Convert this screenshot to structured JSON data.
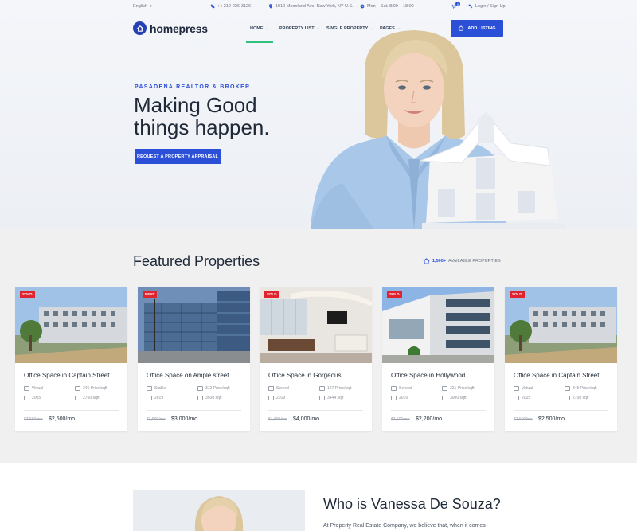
{
  "topbar": {
    "language": "English",
    "phone": "+1 212-226-3126",
    "address": "1010 Moonland Ave, New York, NY U.S.",
    "hours": "Mon – Sat: 8:00 – 18:00",
    "login": "Login / Sign Up",
    "cart_count": "0"
  },
  "header": {
    "logo_text": "homepress",
    "nav": [
      "HOME",
      "PROPERTY LIST",
      "SINGLE PROPERTY",
      "PAGES"
    ],
    "cta_label": "ADD LISTING"
  },
  "hero": {
    "eyebrow": "PASADENA REALTOR & BROKER",
    "headline_line1": "Making Good",
    "headline_line2": "things happen.",
    "cta_label": "REQUEST A PROPERTY APPRAISAL"
  },
  "featured": {
    "title": "Featured Properties",
    "available_count": "1,500+",
    "available_label": "AVAILABLE PROPERTIES",
    "cards": [
      {
        "badge": "SOLD",
        "title": "Office Space in Captain Street",
        "s1": "Virtual",
        "s2": "345 Price/sqft",
        "s3": "2005",
        "s4": "2750 sqft",
        "old_price": "$3,500/mo",
        "price": "$2,500/mo",
        "badge_color": "#e0242f"
      },
      {
        "badge": "RENT",
        "title": "Office Space on Ample street",
        "s1": "Stable",
        "s2": "312 Price/sqft",
        "s3": "2019",
        "s4": "3500 sqft",
        "old_price": "$3,500/mo",
        "price": "$3,000/mo",
        "badge_color": "#e0242f"
      },
      {
        "badge": "SOLD",
        "title": "Office Space in Gorgeous",
        "s1": "Served",
        "s2": "127 Price/sqft",
        "s3": "2019",
        "s4": "3444 sqft",
        "old_price": "$4,800/mo",
        "price": "$4,000/mo",
        "badge_color": "#e0242f"
      },
      {
        "badge": "SOLD",
        "title": "Office Space in Hollywood",
        "s1": "Served",
        "s2": "321 Price/sqft",
        "s3": "2015",
        "s4": "3000 sqft",
        "old_price": "$3,500/mo",
        "price": "$2,200/mo",
        "badge_color": "#e0242f"
      },
      {
        "badge": "SOLD",
        "title": "Office Space in Captain Street",
        "s1": "Virtual",
        "s2": "345 Price/sqft",
        "s3": "2005",
        "s4": "2750 sqft",
        "old_price": "$3,500/mo",
        "price": "$2,500/mo",
        "badge_color": "#e0242f"
      }
    ]
  },
  "who": {
    "title": "Who is Vanessa De Souza?",
    "text": "At Property Real Estate Company, we believe that, when it comes"
  },
  "colors": {
    "accent": "#2b4fd6",
    "badge": "#e0242f",
    "nav_active": "#2ec27e"
  }
}
